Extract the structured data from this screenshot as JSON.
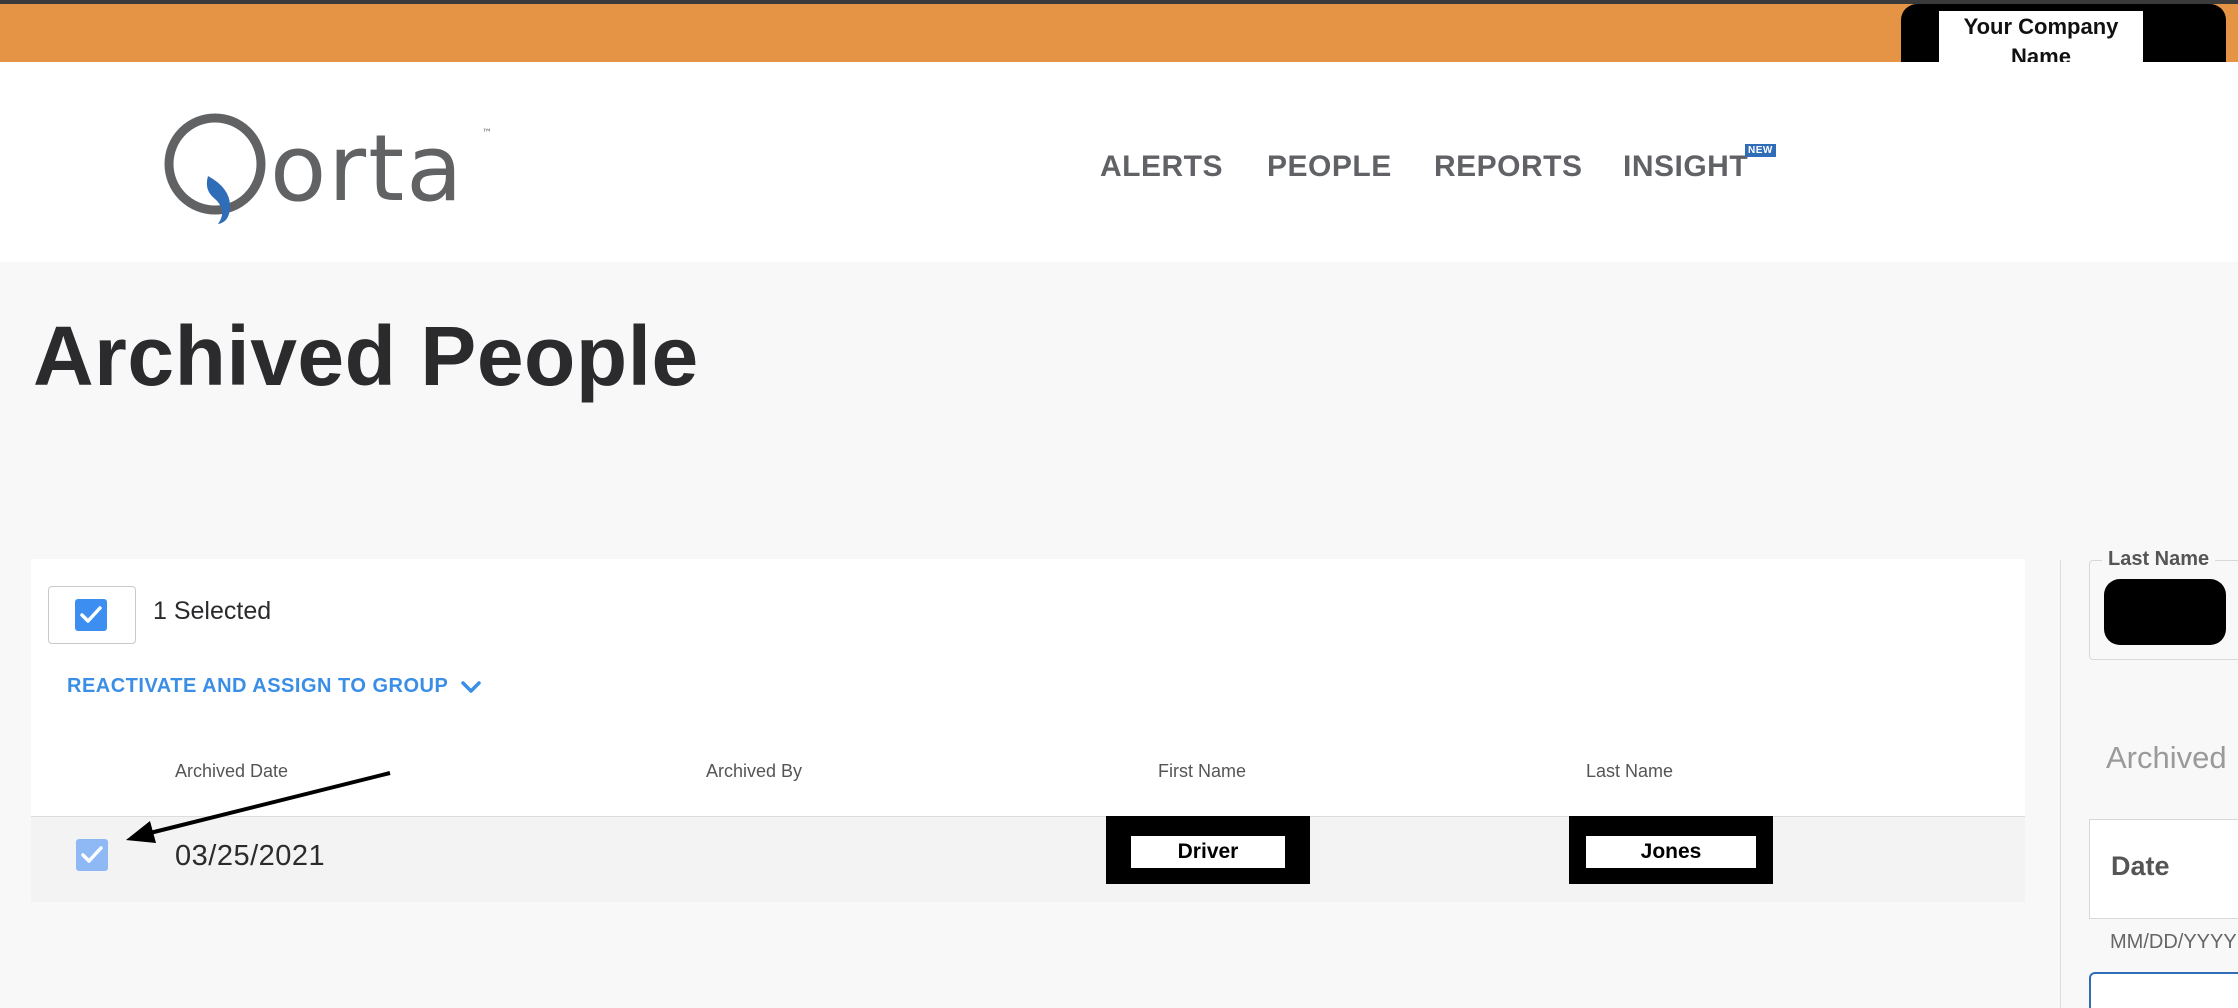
{
  "company": {
    "name": "Your Company Name"
  },
  "nav": {
    "items": [
      {
        "label": "ALERTS"
      },
      {
        "label": "PEOPLE"
      },
      {
        "label": "REPORTS"
      },
      {
        "label": "INSIGHT"
      }
    ],
    "new_badge": "NEW"
  },
  "page": {
    "title": "Archived People"
  },
  "selection": {
    "count_label": "1 Selected",
    "select_all_checked": true
  },
  "actions": {
    "reactivate_label": "REACTIVATE AND ASSIGN TO GROUP"
  },
  "table": {
    "headers": [
      "Archived Date",
      "Archived By",
      "First Name",
      "Last Name"
    ],
    "rows": [
      {
        "checked": true,
        "archived_date": "03/25/2021",
        "archived_by": "",
        "first_name": "Driver",
        "last_name": "Jones"
      }
    ]
  },
  "filters": {
    "last_name_label": "Last Name",
    "archived_label": "Archived",
    "date_label": "Date",
    "date_format": "MM/DD/YYYY"
  },
  "colors": {
    "topbar": "#e59446",
    "accent": "#3a8ee6",
    "checkbox": "#3c8ef0"
  }
}
